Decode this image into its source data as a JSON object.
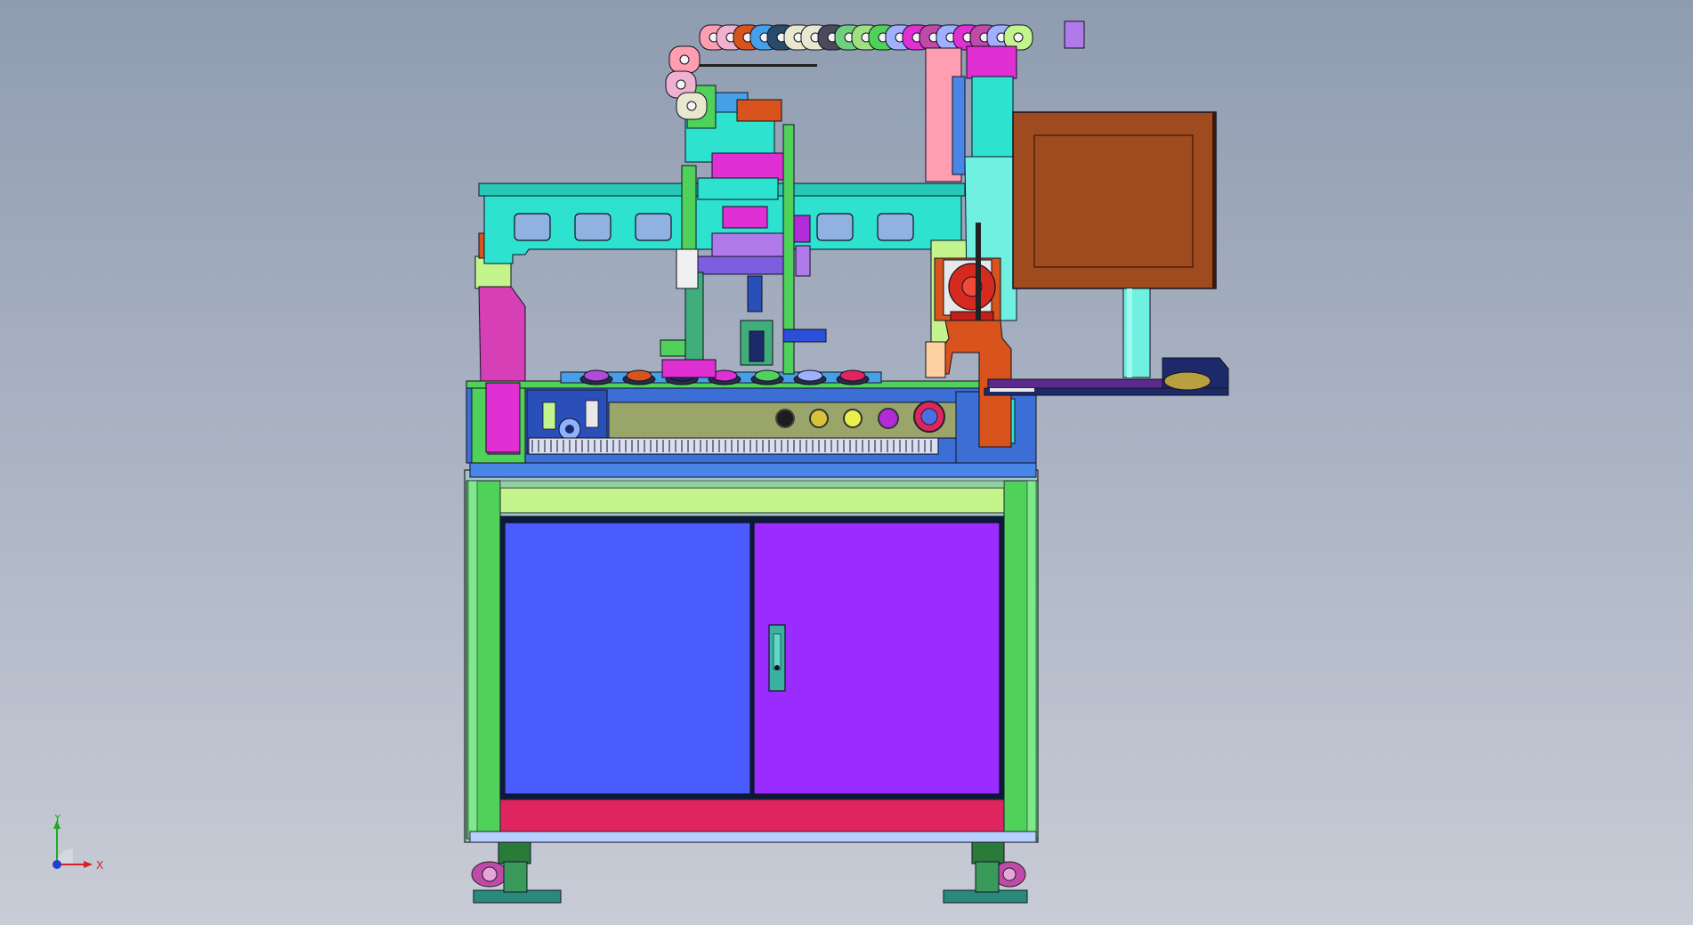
{
  "viewport": {
    "background_top": "#8f9cb0",
    "background_bottom": "#c8ccd6"
  },
  "model": {
    "colors": {
      "cabinet_door_left": "#4b5cff",
      "cabinet_door_right": "#9a2cff",
      "kick_panel": "#e0245f",
      "frame_green": "#4fd15a",
      "light_green": "#c3f58c",
      "gantry_cyan": "#2de3d0",
      "monitor_brown": "#a04a20",
      "magenta": "#e02fd2",
      "pink_column": "#d63fb5",
      "red_motor": "#d62a1e",
      "orange_bracket": "#d9531c",
      "blue_table": "#2f5fd0",
      "olive_panel": "#9aa56a",
      "purple_shelf": "#5a2a8c",
      "navy": "#1d2a6a"
    }
  },
  "triad": {
    "y_label": "Y",
    "x_label": "X",
    "y_color": "#1faa1f",
    "x_color": "#d12222",
    "z_color": "#1f3fd1"
  }
}
